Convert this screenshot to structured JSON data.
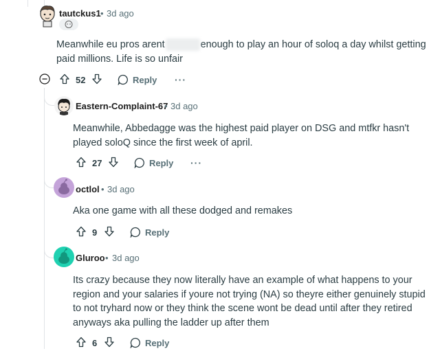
{
  "comments": [
    {
      "username": "tautckus1",
      "time": "3d ago",
      "body_before": "Meanwhile eu pros arent",
      "body_after": "enough to play an hour of soloq a day whilst getting",
      "body_line2": "paid millions. Life is so unfair",
      "votes": "52",
      "reply_label": "Reply",
      "more": "···",
      "avatar_icon": "cartoon-avatar-icon"
    },
    {
      "username": "Eastern-Complaint-67",
      "time": "3d ago",
      "body_line1": "Meanwhile, Abbedagge was the highest paid player on DSG and mtfkr hasn't",
      "body_line2": "played soloQ since the first week of april.",
      "votes": "27",
      "reply_label": "Reply",
      "more": "···",
      "avatar_icon": "dark-hair-avatar-icon"
    },
    {
      "username": "octlol",
      "time": "3d ago",
      "body_line1": "Aka one game with all these dodged and remakes",
      "votes": "9",
      "reply_label": "Reply",
      "avatar_icon": "snoo-avatar-icon",
      "avatar_color": "#c4a3d9"
    },
    {
      "username": "Gluroo",
      "time": "3d ago",
      "body_line1": "Its crazy because they now literally have an example of what happens to your",
      "body_line2": "region and your salaries if youre not trying (NA) so theyre either genuinely stupid",
      "body_line3": "to not tryhard now or they think the scene wont be dead until after they retired",
      "body_line4": "anyways aka pulling the ladder up after them",
      "votes": "6",
      "reply_label": "Reply",
      "avatar_icon": "snoo-avatar-icon",
      "avatar_color": "#1fd1b1"
    }
  ],
  "separator": "•",
  "collapse_icon": "collapse-minus-icon",
  "colors": {
    "meta": "#576f76",
    "thread_line": "#e0e3e6",
    "body": "#2a3c42"
  }
}
